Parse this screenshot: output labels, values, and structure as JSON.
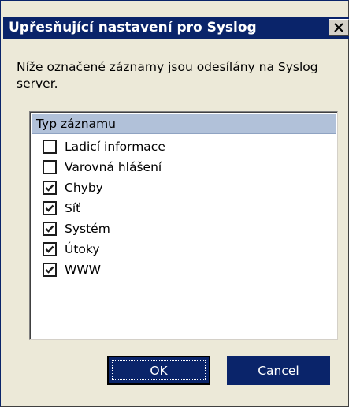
{
  "dialog": {
    "title": "Upřesňující nastavení pro Syslog",
    "description": "Níže označené záznamy jsou odesílány na Syslog server."
  },
  "list": {
    "header": "Typ záznamu",
    "items": [
      {
        "label": "Ladicí informace",
        "checked": false
      },
      {
        "label": "Varovná hlášení",
        "checked": false
      },
      {
        "label": "Chyby",
        "checked": true
      },
      {
        "label": "Síť",
        "checked": true
      },
      {
        "label": "Systém",
        "checked": true
      },
      {
        "label": "Útoky",
        "checked": true
      },
      {
        "label": "WWW",
        "checked": true
      }
    ]
  },
  "buttons": {
    "ok_label": "OK",
    "cancel_label": "Cancel"
  },
  "colors": {
    "title_bar": "#0a246a",
    "dialog_bg": "#ece9d8",
    "list_header_bg": "#b1c1d9",
    "button_bg": "#0a246a"
  }
}
